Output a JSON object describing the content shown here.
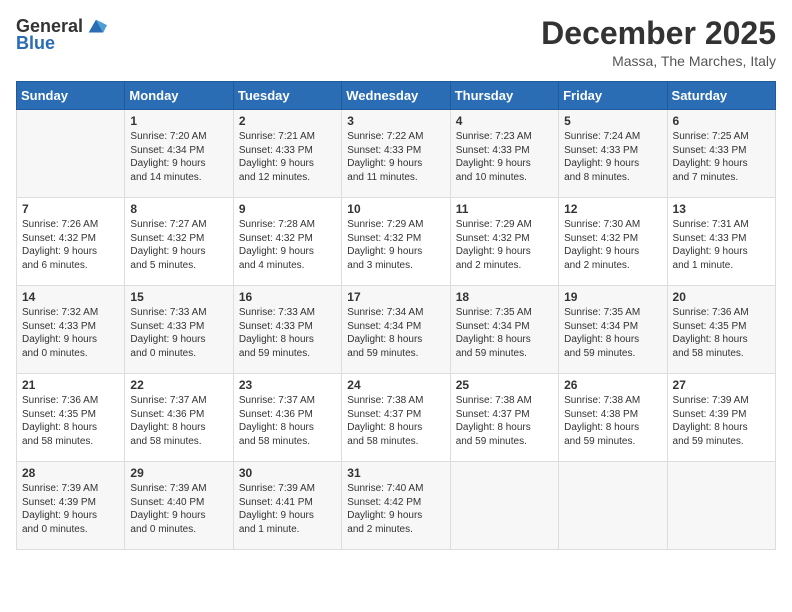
{
  "logo": {
    "general": "General",
    "blue": "Blue"
  },
  "header": {
    "month_title": "December 2025",
    "location": "Massa, The Marches, Italy"
  },
  "days_of_week": [
    "Sunday",
    "Monday",
    "Tuesday",
    "Wednesday",
    "Thursday",
    "Friday",
    "Saturday"
  ],
  "weeks": [
    [
      {
        "day": "",
        "content": ""
      },
      {
        "day": "1",
        "content": "Sunrise: 7:20 AM\nSunset: 4:34 PM\nDaylight: 9 hours\nand 14 minutes."
      },
      {
        "day": "2",
        "content": "Sunrise: 7:21 AM\nSunset: 4:33 PM\nDaylight: 9 hours\nand 12 minutes."
      },
      {
        "day": "3",
        "content": "Sunrise: 7:22 AM\nSunset: 4:33 PM\nDaylight: 9 hours\nand 11 minutes."
      },
      {
        "day": "4",
        "content": "Sunrise: 7:23 AM\nSunset: 4:33 PM\nDaylight: 9 hours\nand 10 minutes."
      },
      {
        "day": "5",
        "content": "Sunrise: 7:24 AM\nSunset: 4:33 PM\nDaylight: 9 hours\nand 8 minutes."
      },
      {
        "day": "6",
        "content": "Sunrise: 7:25 AM\nSunset: 4:33 PM\nDaylight: 9 hours\nand 7 minutes."
      }
    ],
    [
      {
        "day": "7",
        "content": "Sunrise: 7:26 AM\nSunset: 4:32 PM\nDaylight: 9 hours\nand 6 minutes."
      },
      {
        "day": "8",
        "content": "Sunrise: 7:27 AM\nSunset: 4:32 PM\nDaylight: 9 hours\nand 5 minutes."
      },
      {
        "day": "9",
        "content": "Sunrise: 7:28 AM\nSunset: 4:32 PM\nDaylight: 9 hours\nand 4 minutes."
      },
      {
        "day": "10",
        "content": "Sunrise: 7:29 AM\nSunset: 4:32 PM\nDaylight: 9 hours\nand 3 minutes."
      },
      {
        "day": "11",
        "content": "Sunrise: 7:29 AM\nSunset: 4:32 PM\nDaylight: 9 hours\nand 2 minutes."
      },
      {
        "day": "12",
        "content": "Sunrise: 7:30 AM\nSunset: 4:32 PM\nDaylight: 9 hours\nand 2 minutes."
      },
      {
        "day": "13",
        "content": "Sunrise: 7:31 AM\nSunset: 4:33 PM\nDaylight: 9 hours\nand 1 minute."
      }
    ],
    [
      {
        "day": "14",
        "content": "Sunrise: 7:32 AM\nSunset: 4:33 PM\nDaylight: 9 hours\nand 0 minutes."
      },
      {
        "day": "15",
        "content": "Sunrise: 7:33 AM\nSunset: 4:33 PM\nDaylight: 9 hours\nand 0 minutes."
      },
      {
        "day": "16",
        "content": "Sunrise: 7:33 AM\nSunset: 4:33 PM\nDaylight: 8 hours\nand 59 minutes."
      },
      {
        "day": "17",
        "content": "Sunrise: 7:34 AM\nSunset: 4:34 PM\nDaylight: 8 hours\nand 59 minutes."
      },
      {
        "day": "18",
        "content": "Sunrise: 7:35 AM\nSunset: 4:34 PM\nDaylight: 8 hours\nand 59 minutes."
      },
      {
        "day": "19",
        "content": "Sunrise: 7:35 AM\nSunset: 4:34 PM\nDaylight: 8 hours\nand 59 minutes."
      },
      {
        "day": "20",
        "content": "Sunrise: 7:36 AM\nSunset: 4:35 PM\nDaylight: 8 hours\nand 58 minutes."
      }
    ],
    [
      {
        "day": "21",
        "content": "Sunrise: 7:36 AM\nSunset: 4:35 PM\nDaylight: 8 hours\nand 58 minutes."
      },
      {
        "day": "22",
        "content": "Sunrise: 7:37 AM\nSunset: 4:36 PM\nDaylight: 8 hours\nand 58 minutes."
      },
      {
        "day": "23",
        "content": "Sunrise: 7:37 AM\nSunset: 4:36 PM\nDaylight: 8 hours\nand 58 minutes."
      },
      {
        "day": "24",
        "content": "Sunrise: 7:38 AM\nSunset: 4:37 PM\nDaylight: 8 hours\nand 58 minutes."
      },
      {
        "day": "25",
        "content": "Sunrise: 7:38 AM\nSunset: 4:37 PM\nDaylight: 8 hours\nand 59 minutes."
      },
      {
        "day": "26",
        "content": "Sunrise: 7:38 AM\nSunset: 4:38 PM\nDaylight: 8 hours\nand 59 minutes."
      },
      {
        "day": "27",
        "content": "Sunrise: 7:39 AM\nSunset: 4:39 PM\nDaylight: 8 hours\nand 59 minutes."
      }
    ],
    [
      {
        "day": "28",
        "content": "Sunrise: 7:39 AM\nSunset: 4:39 PM\nDaylight: 9 hours\nand 0 minutes."
      },
      {
        "day": "29",
        "content": "Sunrise: 7:39 AM\nSunset: 4:40 PM\nDaylight: 9 hours\nand 0 minutes."
      },
      {
        "day": "30",
        "content": "Sunrise: 7:39 AM\nSunset: 4:41 PM\nDaylight: 9 hours\nand 1 minute."
      },
      {
        "day": "31",
        "content": "Sunrise: 7:40 AM\nSunset: 4:42 PM\nDaylight: 9 hours\nand 2 minutes."
      },
      {
        "day": "",
        "content": ""
      },
      {
        "day": "",
        "content": ""
      },
      {
        "day": "",
        "content": ""
      }
    ]
  ]
}
